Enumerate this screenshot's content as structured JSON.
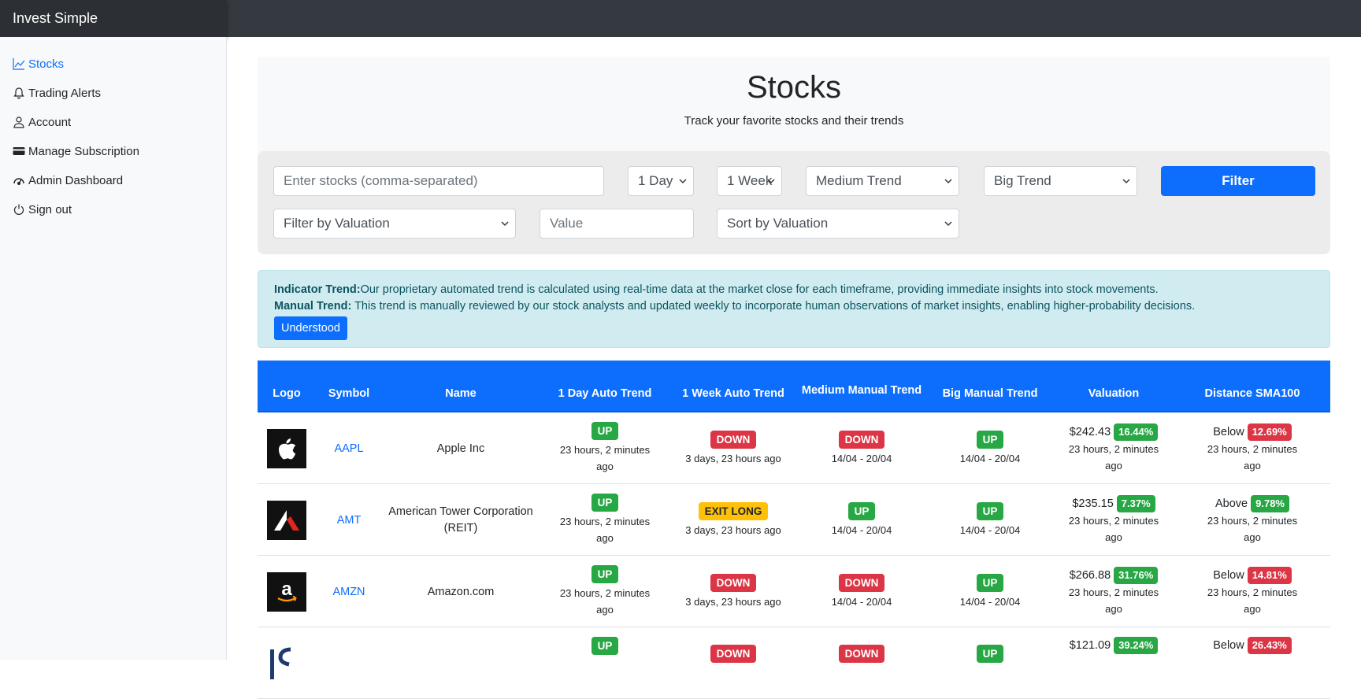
{
  "brand": "Invest Simple",
  "sidebar": {
    "items": [
      {
        "label": "Stocks",
        "icon": "chart-line-icon"
      },
      {
        "label": "Trading Alerts",
        "icon": "bell-icon"
      },
      {
        "label": "Account",
        "icon": "person-icon"
      },
      {
        "label": "Manage Subscription",
        "icon": "credit-card-icon"
      },
      {
        "label": "Admin Dashboard",
        "icon": "speedometer-icon"
      },
      {
        "label": "Sign out",
        "icon": "power-icon"
      }
    ]
  },
  "hero": {
    "title": "Stocks",
    "subtitle": "Track your favorite stocks and their trends"
  },
  "filters": {
    "stocks_placeholder": "Enter stocks (comma-separated)",
    "day_select": "1 Day",
    "week_select": "1 Week",
    "medium_select": "Medium Trend",
    "big_select": "Big Trend",
    "filter_button": "Filter",
    "valuation_select": "Filter by Valuation",
    "value_placeholder": "Value",
    "sort_select": "Sort by Valuation"
  },
  "info": {
    "indicator_label": "Indicator Trend:",
    "indicator_text": "Our proprietary automated trend is calculated using real-time data at the market close for each timeframe, providing immediate insights into stock movements.",
    "manual_label": "Manual Trend:",
    "manual_text": " This trend is manually reviewed by our stock analysts and updated weekly to incorporate human observations of market insights, enabling higher-probability decisions.",
    "button": "Understood"
  },
  "table": {
    "headers": {
      "logo": "Logo",
      "symbol": "Symbol",
      "name": "Name",
      "day_auto": "1 Day Auto Trend",
      "week_auto": "1 Week Auto Trend",
      "medium_manual": "Medium Manual Trend",
      "big_manual": "Big Manual Trend",
      "valuation": "Valuation",
      "distance": "Distance SMA100"
    },
    "rows": [
      {
        "symbol": "AAPL",
        "name": "Apple Inc",
        "day": "UP",
        "day_time": "23 hours, 2 minutes ago",
        "week": "DOWN",
        "week_time": "3 days, 23 hours ago",
        "medium": "DOWN",
        "medium_time": "14/04 - 20/04",
        "big": "UP",
        "big_time": "14/04 - 20/04",
        "price": "$242.43",
        "val_pct": "16.44%",
        "val_time": "23 hours, 2 minutes ago",
        "dist_dir": "Below",
        "dist_pct": "12.69%",
        "dist_time": "23 hours, 2 minutes ago"
      },
      {
        "symbol": "AMT",
        "name": "American Tower Corporation (REIT)",
        "day": "UP",
        "day_time": "23 hours, 2 minutes ago",
        "week": "EXIT LONG",
        "week_time": "3 days, 23 hours ago",
        "medium": "UP",
        "medium_time": "14/04 - 20/04",
        "big": "UP",
        "big_time": "14/04 - 20/04",
        "price": "$235.15",
        "val_pct": "7.37%",
        "val_time": "23 hours, 2 minutes ago",
        "dist_dir": "Above",
        "dist_pct": "9.78%",
        "dist_time": "23 hours, 2 minutes ago"
      },
      {
        "symbol": "AMZN",
        "name": "Amazon.com",
        "day": "UP",
        "day_time": "23 hours, 2 minutes ago",
        "week": "DOWN",
        "week_time": "3 days, 23 hours ago",
        "medium": "DOWN",
        "medium_time": "14/04 - 20/04",
        "big": "UP",
        "big_time": "14/04 - 20/04",
        "price": "$266.88",
        "val_pct": "31.76%",
        "val_time": "23 hours, 2 minutes ago",
        "dist_dir": "Below",
        "dist_pct": "14.81%",
        "dist_time": "23 hours, 2 minutes ago"
      },
      {
        "day": "UP",
        "week": "DOWN",
        "medium": "DOWN",
        "big": "UP",
        "price": "$121.09",
        "val_pct": "39.24%",
        "dist_dir": "Below",
        "dist_pct": "26.43%"
      }
    ]
  },
  "colors": {
    "primary": "#0d6efd",
    "up": "#28a745",
    "down": "#dc3545",
    "exit": "#ffc107",
    "topbar": "#343a40"
  }
}
